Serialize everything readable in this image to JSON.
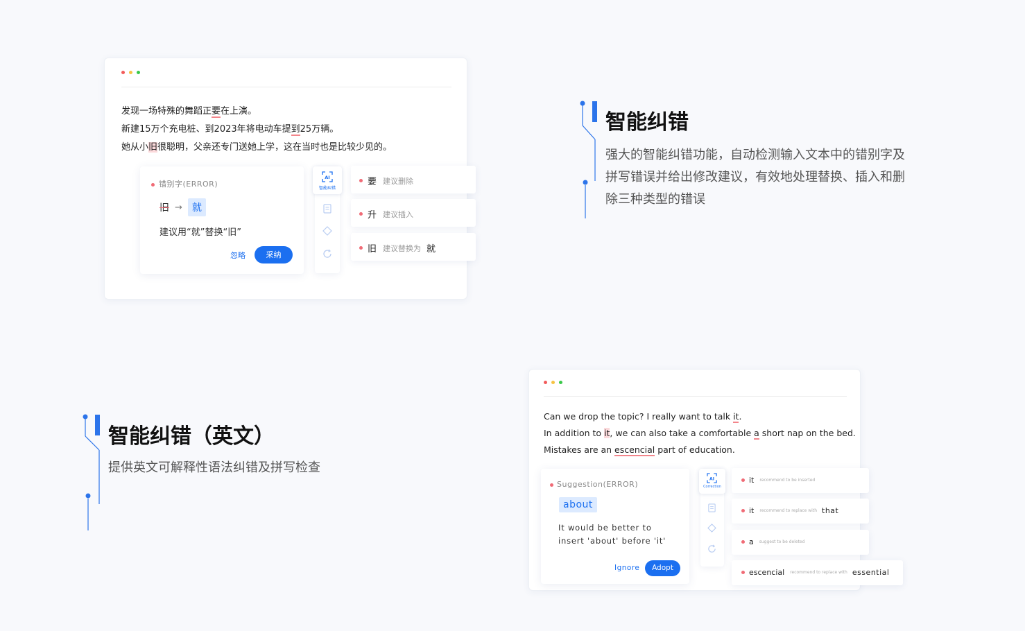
{
  "colors": {
    "accent": "#1b6ff0",
    "error": "#f06b76",
    "dot_red": "#f25b5b",
    "dot_yellow": "#f6c343",
    "dot_green": "#3ac84a"
  },
  "cn_section": {
    "title": "智能纠错",
    "description": "强大的智能纠错功能，自动检测输入文本中的错别字及拼写错误并给出修改建议，有效地处理替换、插入和删除三种类型的错误"
  },
  "en_section": {
    "title": "智能纠错（英文）",
    "description": "提供英文可解释性语法纠错及拼写检查"
  },
  "cn_window": {
    "lines": [
      {
        "before": "发现一场特殊的舞蹈正",
        "mark": "要",
        "after": "在上演。"
      },
      {
        "before": "新建15万个充电桩、到2023年将电动车提",
        "mark": "到",
        "after": "25万辆。"
      },
      {
        "before": "她从小",
        "mark": "旧",
        "after": "很聪明，父亲还专门送她上学，这在当时也是比较少见的。"
      }
    ],
    "card": {
      "type_label": "错别字(ERROR)",
      "wrong": "旧",
      "arrow": "→",
      "right": "就",
      "message": "建议用“就”替换“旧”",
      "ignore_label": "忽略",
      "adopt_label": "采纳"
    },
    "rail": {
      "active_icon": "ai-correction-icon",
      "active_label": "智能纠错",
      "icons": [
        "document-icon",
        "diamond-icon",
        "refresh-icon"
      ]
    },
    "suggestions": [
      {
        "word": "要",
        "hint": "建议删除",
        "target": ""
      },
      {
        "word": "升",
        "hint": "建议插入",
        "target": ""
      },
      {
        "word": "旧",
        "hint": "建议替换为",
        "target": "就"
      }
    ]
  },
  "en_window": {
    "lines": [
      {
        "before": "Can we drop the topic? I really want to talk ",
        "mark": "it",
        "after": "."
      },
      {
        "before": "In addition to ",
        "mark": "it",
        "middle": ", we can also take a comfortable ",
        "mark2": "a",
        "after": " short nap on the bed."
      },
      {
        "before": "Mistakes are an ",
        "mark": "escencial",
        "after": " part of education."
      }
    ],
    "card": {
      "type_label": "Suggestion(ERROR)",
      "word": "about",
      "message_1": "It would be better to",
      "message_2": "insert 'about' before 'it'",
      "ignore_label": "Ignore",
      "adopt_label": "Adopt"
    },
    "rail": {
      "active_icon": "ai-correction-icon",
      "active_label": "Correction",
      "icons": [
        "document-icon",
        "diamond-icon",
        "refresh-icon"
      ]
    },
    "suggestions": [
      {
        "word": "it",
        "hint": "recommend to be inserted",
        "target": ""
      },
      {
        "word": "it",
        "hint": "recommend to replace with",
        "target": "that"
      },
      {
        "word": "a",
        "hint": "suggest to be deleted",
        "target": ""
      },
      {
        "word": "escencial",
        "hint": "recommend to replace with",
        "target": "essential"
      }
    ]
  }
}
